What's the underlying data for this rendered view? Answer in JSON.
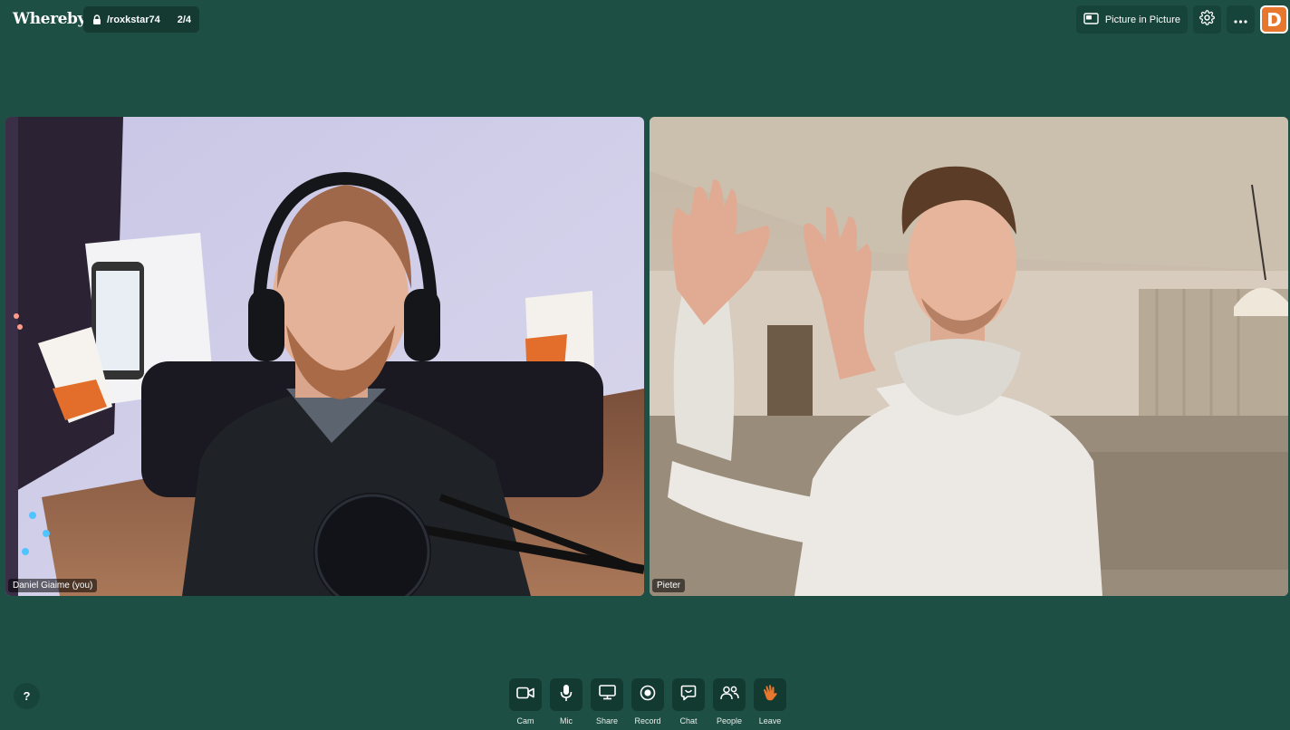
{
  "app": {
    "logo": "Whereby",
    "room": {
      "name": "/roxkstar74",
      "count": "2/4"
    }
  },
  "header": {
    "pip_label": "Picture in Picture",
    "settings_icon": "gear-icon",
    "more_icon": "more-icon",
    "avatar_letter": "D"
  },
  "participants": [
    {
      "name": "Daniel Giaime (you)"
    },
    {
      "name": "Pieter"
    }
  ],
  "controls": [
    {
      "id": "cam",
      "label": "Cam",
      "icon": "camera-icon"
    },
    {
      "id": "mic",
      "label": "Mic",
      "icon": "microphone-icon"
    },
    {
      "id": "share",
      "label": "Share",
      "icon": "screen-share-icon"
    },
    {
      "id": "record",
      "label": "Record",
      "icon": "record-icon"
    },
    {
      "id": "chat",
      "label": "Chat",
      "icon": "chat-icon"
    },
    {
      "id": "people",
      "label": "People",
      "icon": "people-icon"
    },
    {
      "id": "leave",
      "label": "Leave",
      "icon": "wave-hand-icon"
    }
  ],
  "help": {
    "label": "?"
  },
  "colors": {
    "background": "#1e4f44",
    "control_box": "#133a31",
    "avatar": "#e8772e",
    "leave_icon": "#e8772e"
  }
}
